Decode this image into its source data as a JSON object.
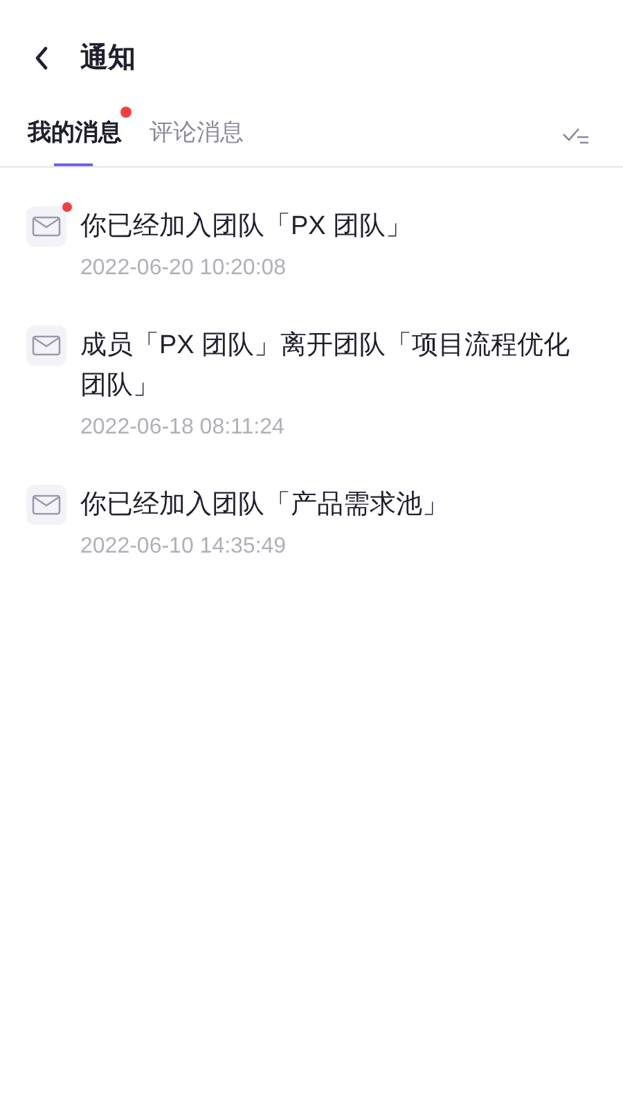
{
  "header": {
    "title": "通知"
  },
  "tabs": [
    {
      "label": "我的消息",
      "selected": true,
      "unread": true
    },
    {
      "label": "评论消息",
      "selected": false,
      "unread": false
    }
  ],
  "messages": [
    {
      "text": "你已经加入团队「PX 团队」",
      "time": "2022-06-20 10:20:08",
      "unread": true
    },
    {
      "text": "成员「PX 团队」离开团队「项目流程优化团队」",
      "time": "2022-06-18 08:11:24",
      "unread": false
    },
    {
      "text": "你已经加入团队「产品需求池」",
      "time": "2022-06-10 14:35:49",
      "unread": false
    }
  ]
}
